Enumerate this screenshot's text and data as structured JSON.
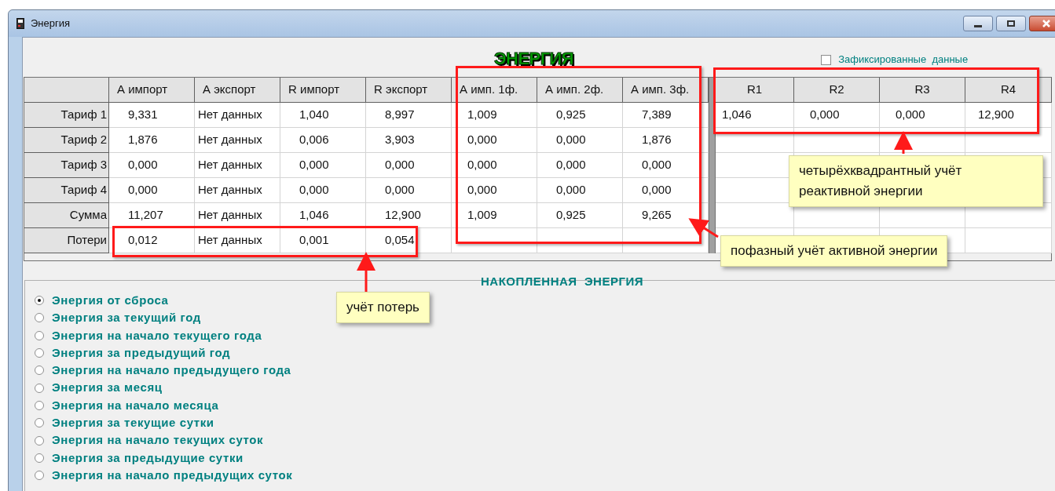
{
  "window": {
    "title": "Энергия"
  },
  "heading": "ЭНЕРГИЯ",
  "fixed_data": {
    "label": "Зафиксированные  данные",
    "checked": false
  },
  "table": {
    "columns": [
      "А импорт",
      "А экспорт",
      "R импорт",
      "R экспорт",
      "А имп. 1ф.",
      "А имп. 2ф.",
      "А имп. 3ф.",
      "R1",
      "R2",
      "R3",
      "R4"
    ],
    "rows": [
      {
        "label": "Тариф 1",
        "cells": [
          "9,331",
          "Нет данных",
          "1,040",
          "8,997",
          "1,009",
          "0,925",
          "7,389",
          "1,046",
          "0,000",
          "0,000",
          "12,900"
        ]
      },
      {
        "label": "Тариф 2",
        "cells": [
          "1,876",
          "Нет данных",
          "0,006",
          "3,903",
          "0,000",
          "0,000",
          "1,876"
        ]
      },
      {
        "label": "Тариф 3",
        "cells": [
          "0,000",
          "Нет данных",
          "0,000",
          "0,000",
          "0,000",
          "0,000",
          "0,000"
        ]
      },
      {
        "label": "Тариф 4",
        "cells": [
          "0,000",
          "Нет данных",
          "0,000",
          "0,000",
          "0,000",
          "0,000",
          "0,000"
        ]
      },
      {
        "label": "Сумма",
        "cells": [
          "11,207",
          "Нет данных",
          "1,046",
          "12,900",
          "1,009",
          "0,925",
          "9,265"
        ]
      },
      {
        "label": "Потери",
        "cells": [
          "0,012",
          "Нет данных",
          "0,001",
          "0,054"
        ]
      }
    ]
  },
  "accumulated": {
    "title": "НАКОПЛЕННАЯ  ЭНЕРГИЯ",
    "options": [
      {
        "label": "Энергия от сброса",
        "selected": true
      },
      {
        "label": "Энергия за текущий год",
        "selected": false
      },
      {
        "label": "Энергия на начало текущего года",
        "selected": false
      },
      {
        "label": "Энергия за предыдущий год",
        "selected": false
      },
      {
        "label": "Энергия на начало предыдущего года",
        "selected": false
      },
      {
        "label": "Энергия за месяц",
        "selected": false
      },
      {
        "label": "Энергия на начало месяца",
        "selected": false
      },
      {
        "label": "Энергия за текущие сутки",
        "selected": false
      },
      {
        "label": "Энергия на начало текущих суток",
        "selected": false
      },
      {
        "label": "Энергия за предыдущие сутки",
        "selected": false
      },
      {
        "label": "Энергия на начало предыдущих суток",
        "selected": false
      }
    ]
  },
  "callouts": [
    "четырёхквадрантный учёт реактивной энергии",
    "пофазный учёт активной энергии",
    "учёт потерь"
  ]
}
